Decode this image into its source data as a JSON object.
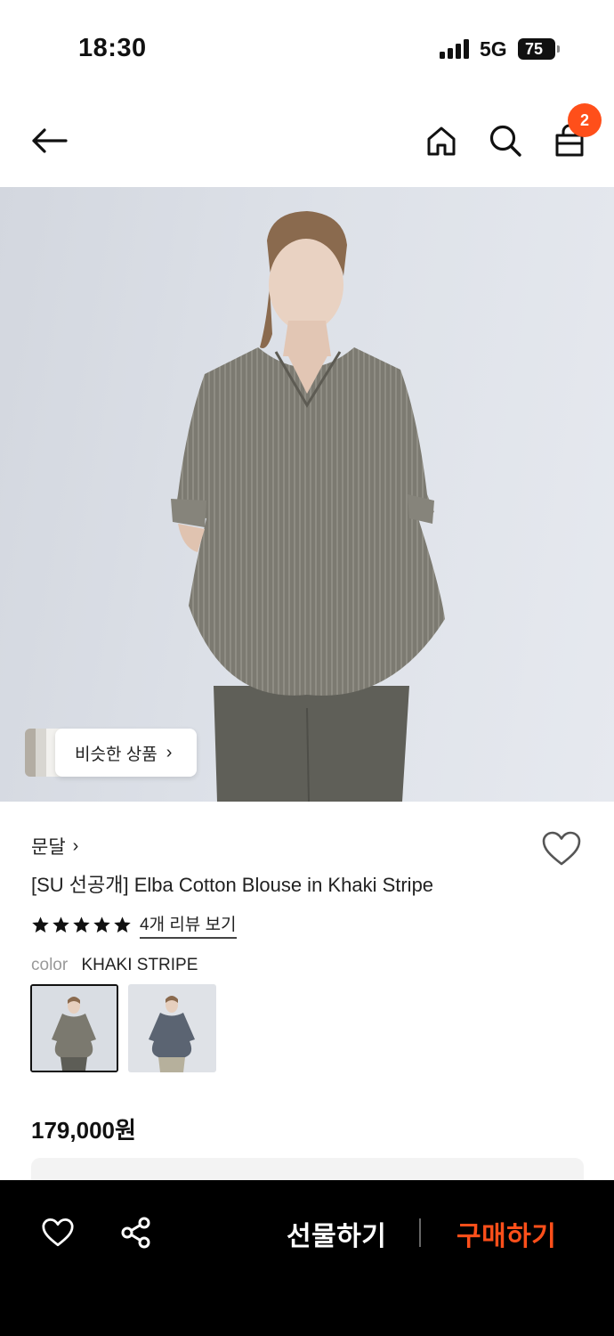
{
  "status_bar": {
    "time": "18:30",
    "network": "5G",
    "battery": "75"
  },
  "nav": {
    "cart_count": "2"
  },
  "hero": {
    "similar_label": "비슷한 상품",
    "similar_chevron": "›"
  },
  "product": {
    "brand": "문달",
    "brand_chevron": "›",
    "title": "[SU 선공개] Elba Cotton Blouse in Khaki Stripe",
    "rating": 5,
    "review_link": "4개 리뷰 보기",
    "color_label": "color",
    "color_value": "KHAKI STRIPE",
    "swatches": [
      {
        "name": "khaki-stripe",
        "selected": true
      },
      {
        "name": "blue-stripe",
        "selected": false
      }
    ],
    "price": "179,000원"
  },
  "bottom_bar": {
    "gift_label": "선물하기",
    "buy_label": "구매하기"
  },
  "colors": {
    "accent": "#ff4f1a",
    "bottom_bar": "#000000",
    "backdrop": "#dde1e8"
  },
  "icons": [
    "back-arrow-icon",
    "home-icon",
    "search-icon",
    "shopping-bag-icon",
    "heart-icon",
    "share-icon",
    "star-icon",
    "chevron-right-icon"
  ]
}
